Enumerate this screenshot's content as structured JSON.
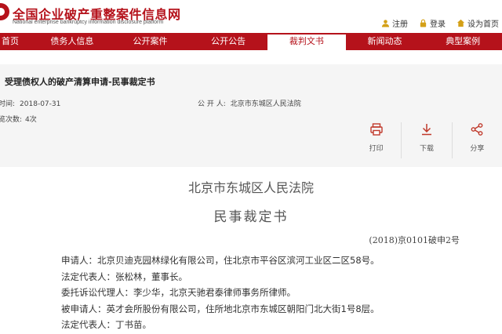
{
  "header": {
    "site_title": "全国企业破产重整案件信息网",
    "site_subtitle": "National enterprise bankruptcy information disclosure platform",
    "links": [
      {
        "icon": "user-icon",
        "label": "注册"
      },
      {
        "icon": "lock-icon",
        "label": "登录"
      },
      {
        "icon": "home-icon",
        "label": "设为首页"
      }
    ]
  },
  "nav": {
    "items": [
      "首页",
      "债务人信息",
      "公开案件",
      "公开公告",
      "裁判文书",
      "新闻动态",
      "典型案例"
    ],
    "active_index": 4
  },
  "document": {
    "title": "受理债权人的破产清算申请-民事裁定书",
    "publish_time_label": "时间:",
    "publish_time": "2018-07-31",
    "publisher_label": "公 开 人:",
    "publisher": "北京市东城区人民法院",
    "views_label": "览次数:",
    "views": "4次",
    "actions": [
      {
        "icon": "print-icon",
        "label": "打印"
      },
      {
        "icon": "download-icon",
        "label": "下载"
      },
      {
        "icon": "share-icon",
        "label": "分享"
      }
    ],
    "court": "北京市东城区人民法院",
    "doc_type": "民事裁定书",
    "case_no": "(2018)京0101破申2号",
    "paragraphs": [
      "申请人：北京贝迪克园林绿化有限公司，住北京市平谷区滨河工业区二区58号。",
      "法定代表人：张松林，董事长。",
      "委托诉讼代理人：李少华，北京天驰君泰律师事务所律师。",
      "被申请人：英才会所股份有限公司，住所地北京市东城区朝阳门北大街1号8层。",
      "法定代表人：丁书苗。"
    ]
  },
  "colors": {
    "brand_red": "#b5121b",
    "panel_bg": "#f5f5f5"
  }
}
